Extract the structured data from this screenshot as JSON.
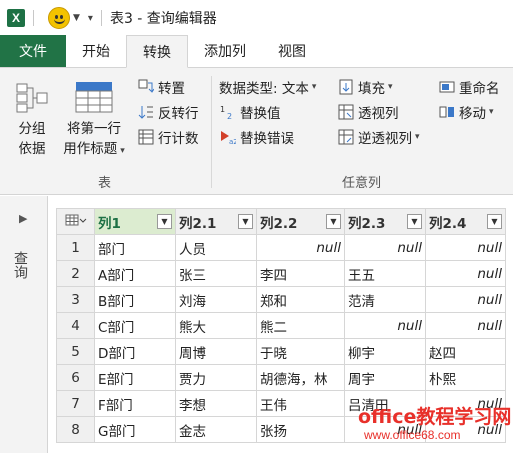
{
  "window": {
    "title": "表3 - 查询编辑器",
    "app_icon": "excel-icon"
  },
  "tabs": [
    {
      "label": "文件",
      "active": false
    },
    {
      "label": "开始",
      "active": false
    },
    {
      "label": "转换",
      "active": true
    },
    {
      "label": "添加列",
      "active": false
    },
    {
      "label": "视图",
      "active": false
    }
  ],
  "ribbon": {
    "table_group": {
      "label": "表",
      "group_by": "分组\n依据",
      "use_first_row": "将第一行\n用作标题",
      "transpose": "转置",
      "reverse_rows": "反转行",
      "count_rows": "行计数"
    },
    "any_column_group": {
      "label": "任意列",
      "data_type": "数据类型: 文本",
      "replace_values": "替换值",
      "replace_errors": "替换错误",
      "fill": "填充",
      "pivot": "透视列",
      "unpivot": "逆透视列",
      "rename": "重命名",
      "move": "移动"
    }
  },
  "queries_pane": {
    "label": "查询"
  },
  "grid": {
    "columns": [
      "列1",
      "列2.1",
      "列2.2",
      "列2.3",
      "列2.4"
    ],
    "rows": [
      {
        "n": "1",
        "cells": [
          "部门",
          "人员",
          "null",
          "null",
          "null"
        ]
      },
      {
        "n": "2",
        "cells": [
          "A部门",
          "张三",
          "李四",
          "王五",
          "null"
        ]
      },
      {
        "n": "3",
        "cells": [
          "B部门",
          "刘海",
          "郑和",
          "范清",
          "null"
        ]
      },
      {
        "n": "4",
        "cells": [
          "C部门",
          "熊大",
          "熊二",
          "null",
          "null"
        ]
      },
      {
        "n": "5",
        "cells": [
          "D部门",
          "周博",
          "于晓",
          "柳宇",
          "赵四"
        ]
      },
      {
        "n": "6",
        "cells": [
          "E部门",
          "贾力",
          "胡德海，林",
          "周宇",
          "朴熙"
        ]
      },
      {
        "n": "7",
        "cells": [
          "F部门",
          "李想",
          "王伟",
          "吕清田",
          "null"
        ]
      },
      {
        "n": "8",
        "cells": [
          "G部门",
          "金志",
          "张扬",
          "null",
          "null"
        ]
      }
    ]
  },
  "watermark": {
    "line1": "office教程学习网",
    "line2": "www.office68.com"
  }
}
